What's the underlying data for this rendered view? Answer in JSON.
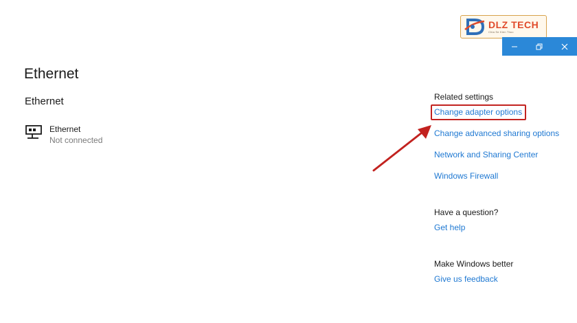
{
  "logo": {
    "name": "DLZ TECH",
    "tagline": "Chia Se Kien Thuc"
  },
  "window_controls": {
    "minimize_icon": "minimize-icon",
    "restore_icon": "restore-icon",
    "close_icon": "close-icon",
    "accent_color": "#2b88d8"
  },
  "main": {
    "page_title": "Ethernet",
    "section_title": "Ethernet",
    "adapter": {
      "icon": "network-adapter-icon",
      "name": "Ethernet",
      "status": "Not connected"
    }
  },
  "related_settings": {
    "heading": "Related settings",
    "links": [
      "Change adapter options",
      "Change advanced sharing options",
      "Network and Sharing Center",
      "Windows Firewall"
    ]
  },
  "question": {
    "heading": "Have a question?",
    "link": "Get help"
  },
  "feedback": {
    "heading": "Make Windows better",
    "link": "Give us feedback"
  },
  "annotation": {
    "highlight_color": "#c2221f",
    "link_color": "#1e78d2"
  }
}
